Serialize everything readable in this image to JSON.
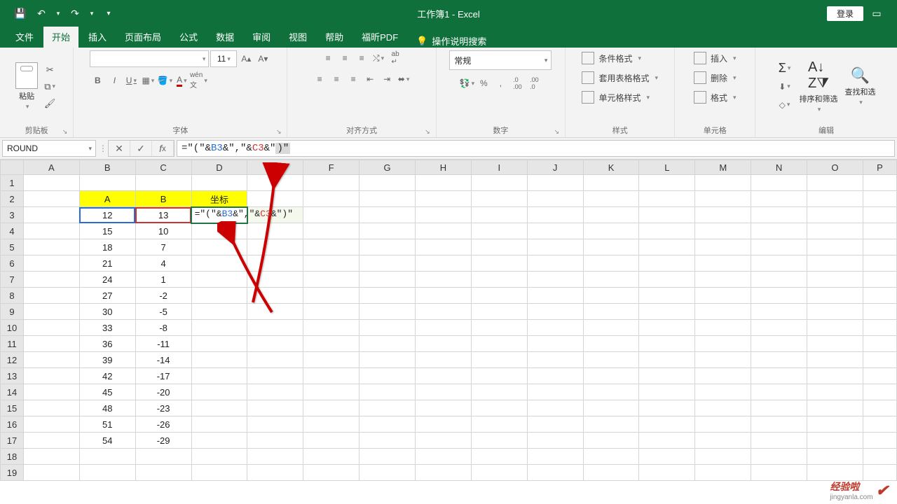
{
  "window": {
    "title_left": "工作簿1",
    "title_sep": " - ",
    "title_app": "Excel",
    "login": "登录"
  },
  "qat": {
    "save": "save-icon",
    "undo": "undo-icon",
    "redo": "redo-icon",
    "customize": "customize-qat-icon"
  },
  "tabs": {
    "file": "文件",
    "home": "开始",
    "insert": "插入",
    "layout": "页面布局",
    "formulas": "公式",
    "data": "数据",
    "review": "审阅",
    "view": "视图",
    "help": "帮助",
    "foxit": "福昕PDF",
    "tellme": "操作说明搜索"
  },
  "groups": {
    "clipboard": "剪贴板",
    "paste": "粘贴",
    "font": "字体",
    "align": "对齐方式",
    "number": "数字",
    "styles": "样式",
    "cells": "单元格",
    "editing": "编辑"
  },
  "font": {
    "name": "",
    "size": "11",
    "bold": "B",
    "italic": "I",
    "underline": "U"
  },
  "number_format": "常规",
  "styles_items": {
    "cond": "条件格式",
    "table": "套用表格格式",
    "cell": "单元格样式"
  },
  "cells_items": {
    "insert": "插入",
    "delete": "删除",
    "format": "格式"
  },
  "editing_items": {
    "sort": "排序和筛选",
    "find": "查找和选"
  },
  "name_box": "ROUND",
  "formula": {
    "p1": "=\"(\"&",
    "ref1": "B3",
    "p2": "&\",\"&",
    "ref2": "C3",
    "p3": "&\"",
    "p4": ")\""
  },
  "headers": {
    "A": "A",
    "B": "B",
    "C": "C",
    "D": "D",
    "E": "E",
    "F": "F",
    "G": "G",
    "H": "H",
    "I": "I",
    "J": "J",
    "K": "K",
    "L": "L",
    "M": "M",
    "N": "N",
    "O": "O",
    "P": "P"
  },
  "sheet": {
    "header_row": {
      "B": "A",
      "C": "B",
      "D": "坐标"
    },
    "rows": [
      {
        "r": 3,
        "B": "12",
        "C": "13",
        "D_formula": true
      },
      {
        "r": 4,
        "B": "15",
        "C": "10"
      },
      {
        "r": 5,
        "B": "18",
        "C": "7"
      },
      {
        "r": 6,
        "B": "21",
        "C": "4"
      },
      {
        "r": 7,
        "B": "24",
        "C": "1"
      },
      {
        "r": 8,
        "B": "27",
        "C": "-2"
      },
      {
        "r": 9,
        "B": "30",
        "C": "-5"
      },
      {
        "r": 10,
        "B": "33",
        "C": "-8"
      },
      {
        "r": 11,
        "B": "36",
        "C": "-11"
      },
      {
        "r": 12,
        "B": "39",
        "C": "-14"
      },
      {
        "r": 13,
        "B": "42",
        "C": "-17"
      },
      {
        "r": 14,
        "B": "45",
        "C": "-20"
      },
      {
        "r": 15,
        "B": "48",
        "C": "-23"
      },
      {
        "r": 16,
        "B": "51",
        "C": "-26"
      },
      {
        "r": 17,
        "B": "54",
        "C": "-29"
      }
    ]
  },
  "watermark": {
    "main": "经验啦",
    "sub": "jingyanla.com"
  }
}
